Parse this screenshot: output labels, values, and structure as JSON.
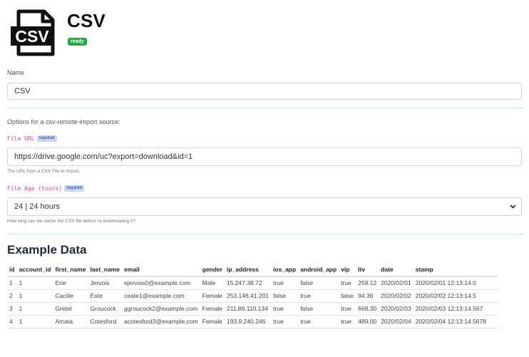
{
  "header": {
    "title": "CSV",
    "logo_text": "CSV",
    "status_badge": "ready"
  },
  "name_field": {
    "label": "Name",
    "value": "CSV"
  },
  "options": {
    "intro": "Options for a csv-remote-import source:",
    "file_url": {
      "label": "File URL",
      "required_badge": "required",
      "value": "https://drive.google.com/uc?export=download&id=1",
      "help": "The URL from a CSV File to import."
    },
    "file_age": {
      "label": "File Age (hours)",
      "required_badge": "required",
      "selected": "24 | 24 hours",
      "help": "How long can we cache the CSV file before re-downloading it?"
    }
  },
  "example": {
    "title": "Example Data",
    "columns": [
      "id",
      "account_id",
      "first_name",
      "last_name",
      "email",
      "gender",
      "ip_address",
      "ios_app",
      "android_app",
      "vip",
      "ltv",
      "date",
      "stamp"
    ],
    "rows": [
      [
        "1",
        "1",
        "Erie",
        "Jervois",
        "ejervois0@example.com",
        "Male",
        "15.247.38.72",
        "true",
        "false",
        "true",
        "259.12",
        "2020/02/01",
        "2020/02/01 12:13:14.0"
      ],
      [
        "2",
        "1",
        "Cacilie",
        "Eate",
        "ceate1@example.com",
        "Female",
        "253.146.41.201",
        "false",
        "true",
        "false",
        "94.36",
        "2020/02/02",
        "2020/02/02 12:13:14.5"
      ],
      [
        "3",
        "1",
        "Gretel",
        "Groucock",
        "ggroucock2@example.com",
        "Female",
        "211.89.110.134",
        "true",
        "false",
        "true",
        "668.30",
        "2020/02/03",
        "2020/02/03 12:13:14.567"
      ],
      [
        "4",
        "1",
        "Amata",
        "Cotesford",
        "acotesford3@example.com",
        "Female",
        "193.9.240.246",
        "true",
        "true",
        "true",
        "489.00",
        "2020/02/04",
        "2020/02/04 12:13:14.5678"
      ]
    ]
  },
  "icons": {
    "logo": "csv-file-icon",
    "select_arrow": "chevron-down-icon"
  },
  "colors": {
    "ready_badge": "#28a745",
    "code_label": "#e83e8c",
    "divider": "#bfe3f3"
  }
}
